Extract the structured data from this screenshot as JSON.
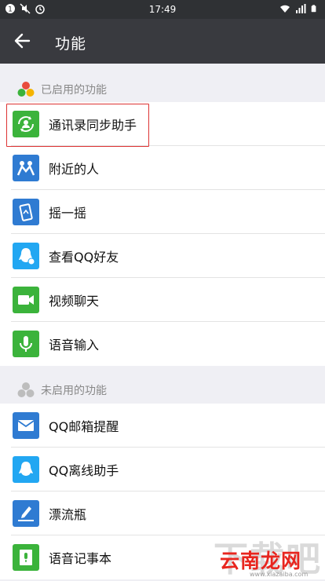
{
  "status_bar": {
    "time": "17:49"
  },
  "app_bar": {
    "title": "功能"
  },
  "enabled_section": {
    "title": "已启用的功能",
    "items": [
      {
        "label": "通讯录同步助手",
        "icon": "contacts-sync-icon",
        "color": "#3bb33b"
      },
      {
        "label": "附近的人",
        "icon": "nearby-people-icon",
        "color": "#2f7bd2"
      },
      {
        "label": "摇一摇",
        "icon": "shake-icon",
        "color": "#2f7bd2"
      },
      {
        "label": "查看QQ好友",
        "icon": "qq-friends-icon",
        "color": "#22a7f2"
      },
      {
        "label": "视频聊天",
        "icon": "video-chat-icon",
        "color": "#3bb33b"
      },
      {
        "label": "语音输入",
        "icon": "voice-input-icon",
        "color": "#3bb33b"
      }
    ]
  },
  "disabled_section": {
    "title": "未启用的功能",
    "items": [
      {
        "label": "QQ邮箱提醒",
        "icon": "qq-mail-icon",
        "color": "#2f7bd2"
      },
      {
        "label": "QQ离线助手",
        "icon": "qq-offline-icon",
        "color": "#22a7f2"
      },
      {
        "label": "漂流瓶",
        "icon": "drift-bottle-icon",
        "color": "#2f7bd2"
      },
      {
        "label": "语音记事本",
        "icon": "voice-notepad-icon",
        "color": "#3bb33b"
      }
    ]
  },
  "watermark": {
    "text": "云南龙网",
    "url": "www.xiazaiba.com",
    "big": "下载吧"
  }
}
